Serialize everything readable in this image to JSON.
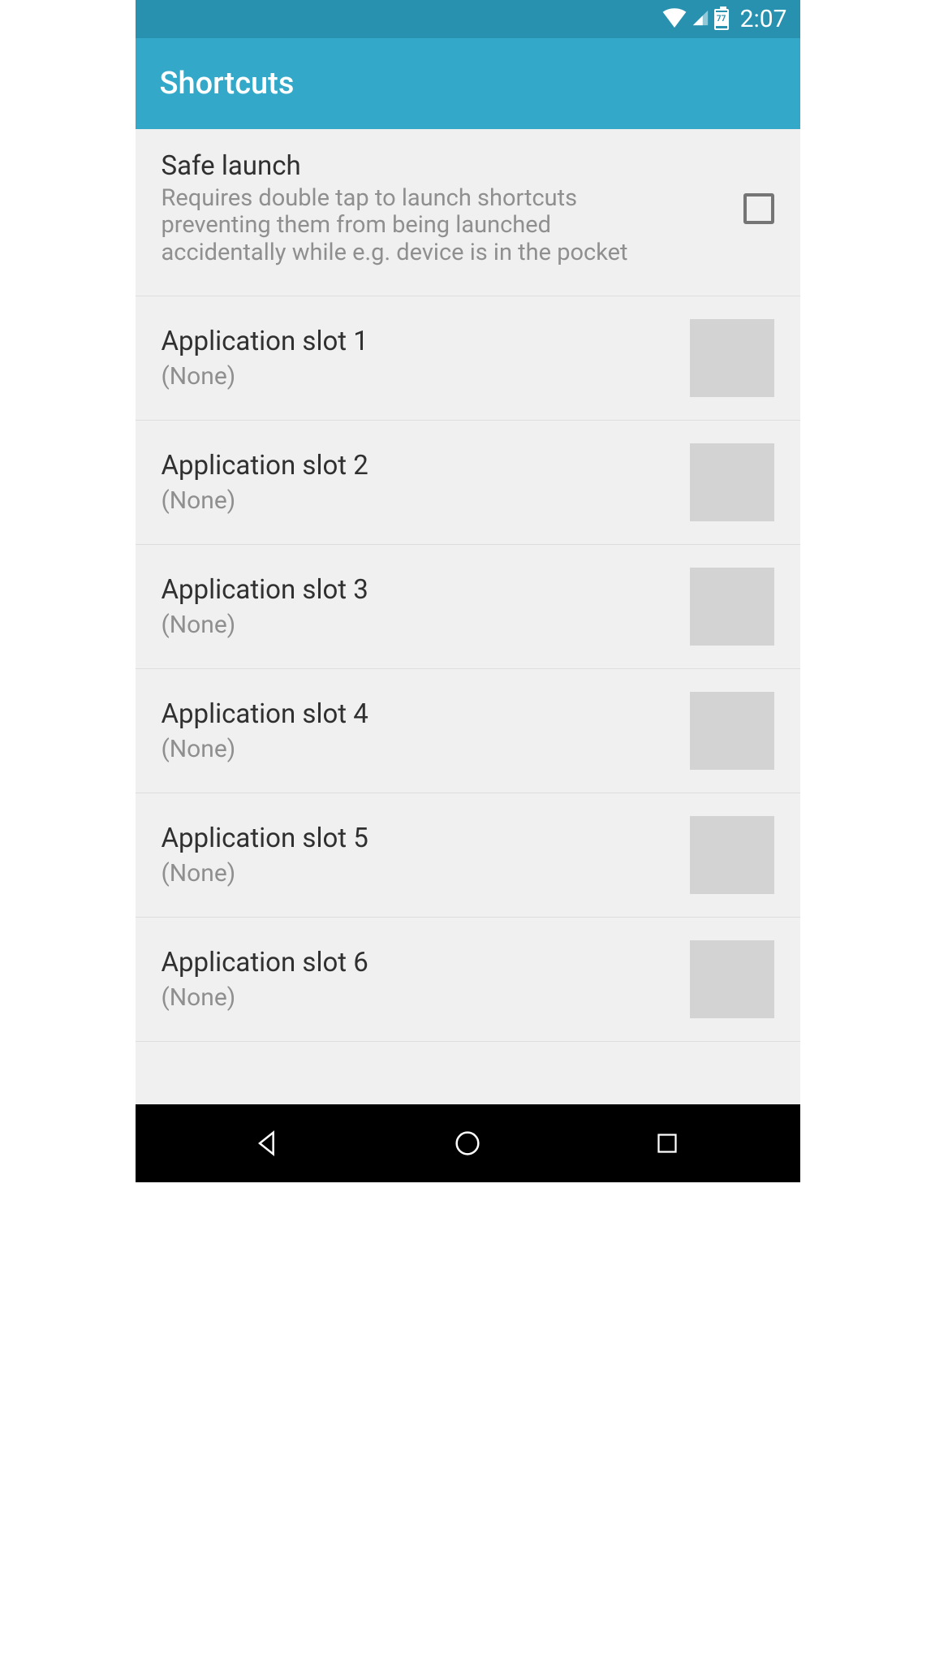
{
  "status": {
    "battery_level": "77",
    "time": "2:07"
  },
  "header": {
    "title": "Shortcuts"
  },
  "safe_launch": {
    "title": "Safe launch",
    "description": "Requires double tap to launch shortcuts preventing them from being launched accidentally while e.g. device is in the pocket",
    "checked": false
  },
  "slots": [
    {
      "title": "Application slot 1",
      "value": "(None)"
    },
    {
      "title": "Application slot 2",
      "value": "(None)"
    },
    {
      "title": "Application slot 3",
      "value": "(None)"
    },
    {
      "title": "Application slot 4",
      "value": "(None)"
    },
    {
      "title": "Application slot 5",
      "value": "(None)"
    },
    {
      "title": "Application slot 6",
      "value": "(None)"
    }
  ]
}
